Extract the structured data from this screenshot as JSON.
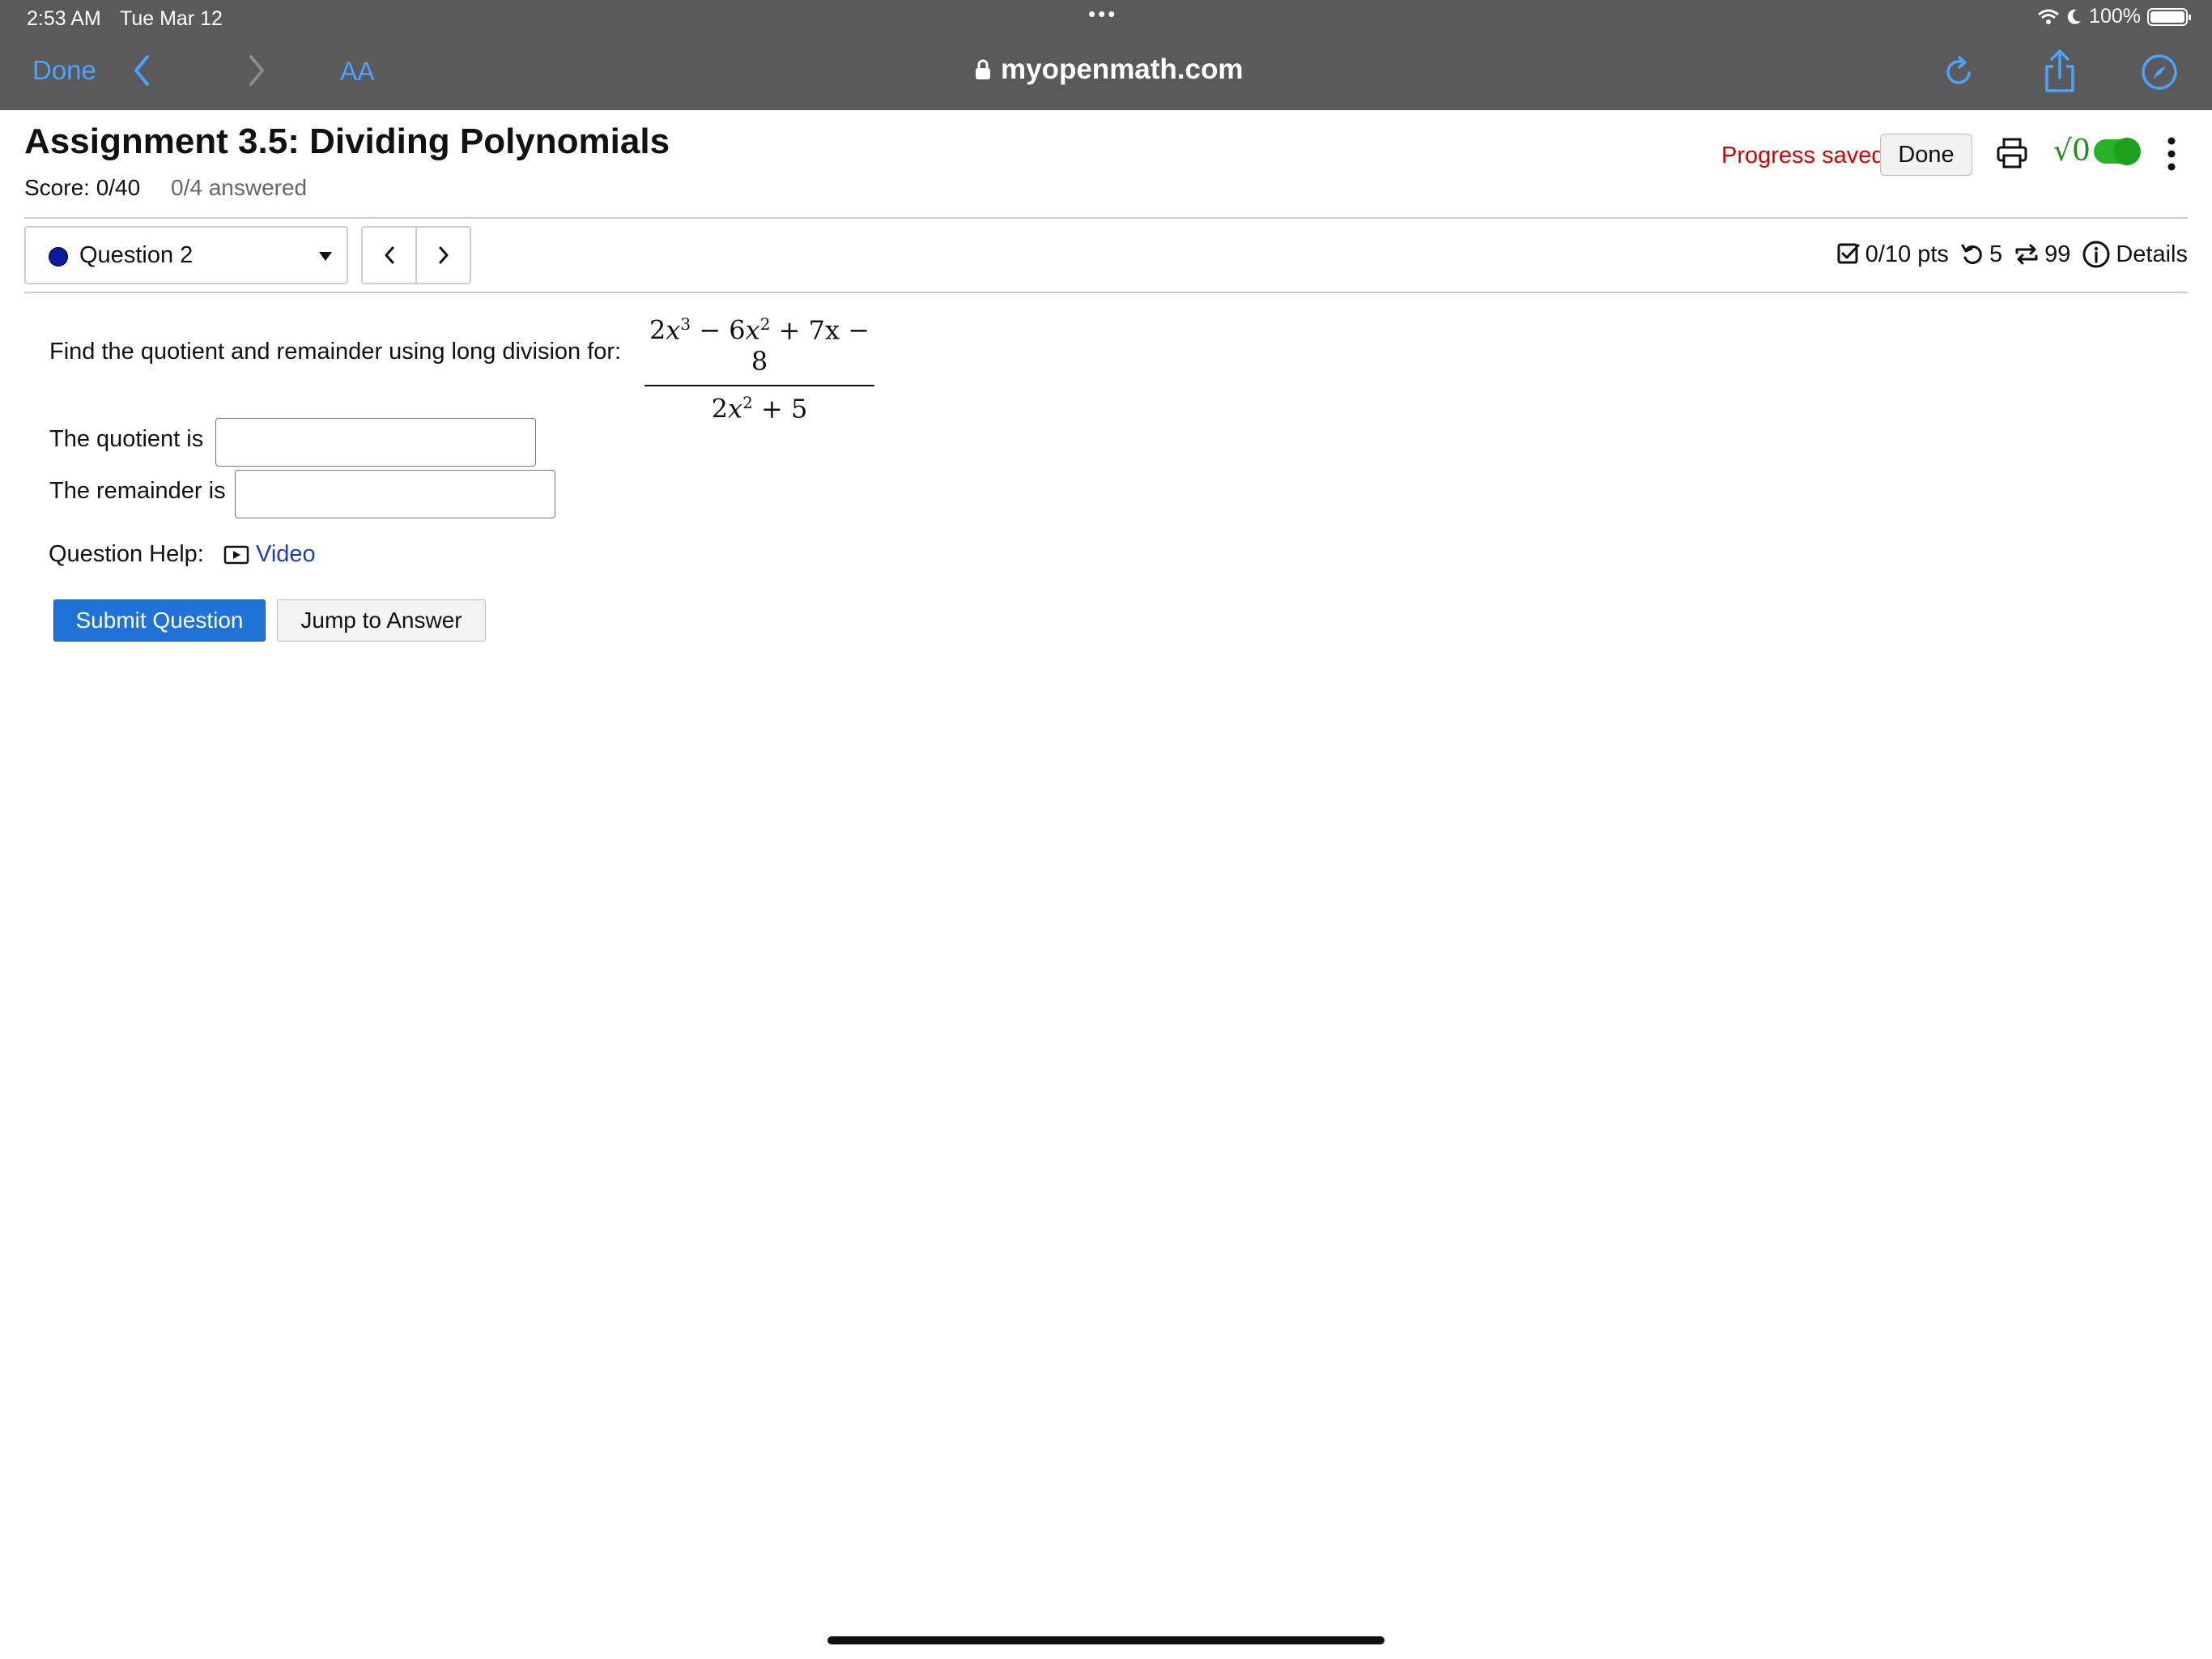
{
  "status_bar": {
    "time": "2:53 AM",
    "date": "Tue Mar 12",
    "battery": "100%"
  },
  "browser": {
    "done_label": "Done",
    "text_size_label": "AA",
    "url": "myopenmath.com"
  },
  "assignment": {
    "title": "Assignment 3.5: Dividing Polynomials",
    "score": "Score: 0/40",
    "answered": "0/4 answered",
    "progress_saved": "Progress saved",
    "done_label": "Done"
  },
  "question_nav": {
    "selected": "Question 2",
    "points": "0/10 pts",
    "retries": "5",
    "regens": "99",
    "details": "Details"
  },
  "question": {
    "prompt": "Find the quotient and remainder using long division for:",
    "numerator": {
      "t1c": "2",
      "t1v": "x",
      "t1e": "3",
      "op1": "−",
      "t2c": "6",
      "t2v": "x",
      "t2e": "2",
      "op2": "+",
      "t3": "7x",
      "op3": "−",
      "t4": "8"
    },
    "denominator": {
      "t1c": "2",
      "t1v": "x",
      "t1e": "2",
      "op1": "+",
      "t2": "5"
    },
    "quotient_label": "The quotient is",
    "quotient_value": "",
    "remainder_label": "The remainder is",
    "remainder_value": "",
    "help_label": "Question Help:",
    "video_label": "Video",
    "submit_label": "Submit Question",
    "jump_label": "Jump to Answer"
  },
  "colors": {
    "accent": "#1f73d8",
    "saved": "#d40000",
    "toggle": "#29b329",
    "link": "#1a3fb0",
    "chrome": "#5a5a5a"
  }
}
